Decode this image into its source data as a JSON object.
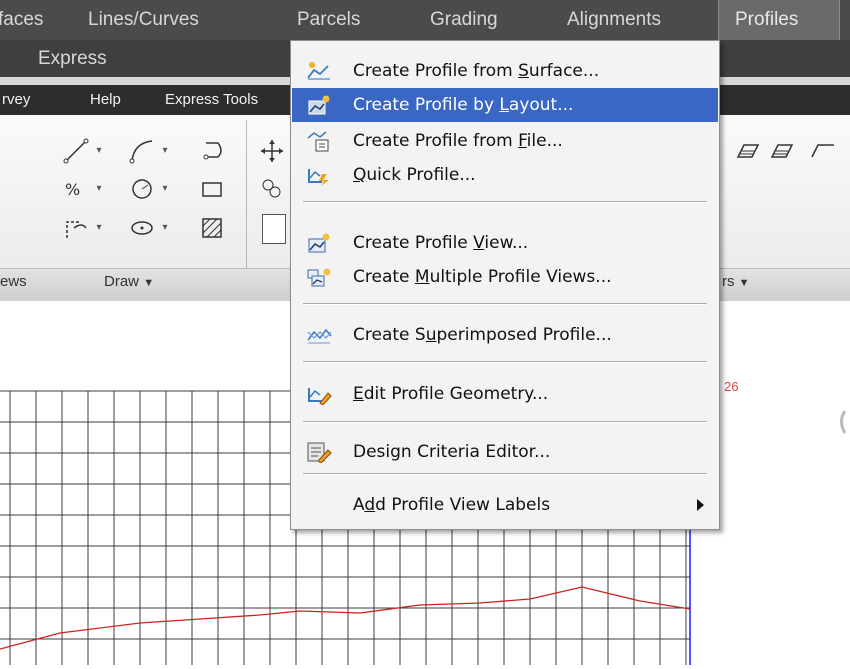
{
  "menubar": {
    "items": [
      {
        "label": "faces"
      },
      {
        "label": "Lines/Curves"
      },
      {
        "label": "Parcels"
      },
      {
        "label": "Grading"
      },
      {
        "label": "Alignments"
      },
      {
        "label": "Profiles"
      }
    ],
    "row2": {
      "label": "Express"
    }
  },
  "submenubar": {
    "items": [
      {
        "label": "rvey"
      },
      {
        "label": "Help"
      },
      {
        "label": "Express Tools"
      }
    ]
  },
  "ribbon": {
    "panels": [
      {
        "label": "ews"
      },
      {
        "label": "Draw",
        "has_dropdown": true
      },
      {
        "label": "rs",
        "has_dropdown": true
      }
    ]
  },
  "canvas": {
    "annotation": "26",
    "grid_color": "#3c3c3c",
    "profile_line_color": "#cc2222",
    "vertical_line_color": "#1a1aff"
  },
  "dropdown": {
    "items": [
      {
        "label_pre": "Create Profile from ",
        "label_key": "S",
        "label_post": "urface...",
        "icon": "profile-from-surface-icon"
      },
      {
        "label_pre": "Create Profile by ",
        "label_key": "L",
        "label_post": "ayout...",
        "icon": "profile-by-layout-icon",
        "selected": true
      },
      {
        "label_pre": "Create Profile from ",
        "label_key": "F",
        "label_post": "ile...",
        "icon": "profile-from-file-icon"
      },
      {
        "label_pre": "",
        "label_key": "Q",
        "label_post": "uick Profile...",
        "icon": "quick-profile-icon"
      },
      {
        "label_pre": "Create Profile ",
        "label_key": "V",
        "label_post": "iew...",
        "icon": "profile-view-icon"
      },
      {
        "label_pre": "Create ",
        "label_key": "M",
        "label_post": "ultiple Profile Views...",
        "icon": "multiple-profile-views-icon"
      },
      {
        "label_pre": "Create S",
        "label_key": "u",
        "label_post": "perimposed Profile...",
        "icon": "superimposed-profile-icon"
      },
      {
        "label_pre": "",
        "label_key": "E",
        "label_post": "dit Profile Geometry...",
        "icon": "edit-profile-geometry-icon"
      },
      {
        "label_pre": "Design Criteria Editor...",
        "label_key": "",
        "label_post": "",
        "icon": "design-criteria-editor-icon"
      },
      {
        "label_pre": "A",
        "label_key": "d",
        "label_post": "d Profile View Labels",
        "icon": "",
        "submenu": true
      }
    ]
  },
  "colors": {
    "menubar_bg": "#4b4b4b",
    "selection": "#3a66c4"
  }
}
